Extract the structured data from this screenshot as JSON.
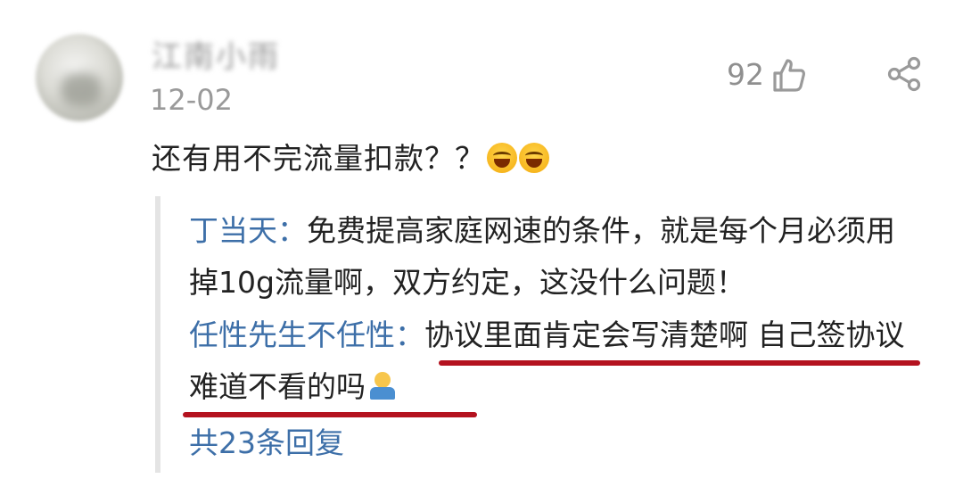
{
  "comment": {
    "username": "江南小雨",
    "date": "12-02",
    "likes": "92",
    "text": "还有用不完流量扣款？？",
    "emojis": [
      "laughing-tears-emoji",
      "laughing-tears-emoji"
    ]
  },
  "replies": [
    {
      "author": "丁当天",
      "separator": "：",
      "text": "免费提高家庭网速的条件，就是每个月必须用掉10g流量啊，双方约定，这没什么问题！"
    },
    {
      "author": "任性先生不任性",
      "separator": "：",
      "text": "协议里面肯定会写清楚啊 自己签协议难道不看的吗",
      "emoji": "shrug-emoji"
    }
  ],
  "more_replies": "共23条回复",
  "icons": {
    "like": "thumbs-up-icon",
    "share": "share-icon"
  },
  "colors": {
    "author_link": "#3d6fa8",
    "annotation_underline": "#b4121f",
    "secondary_text": "#9a9a9a"
  }
}
